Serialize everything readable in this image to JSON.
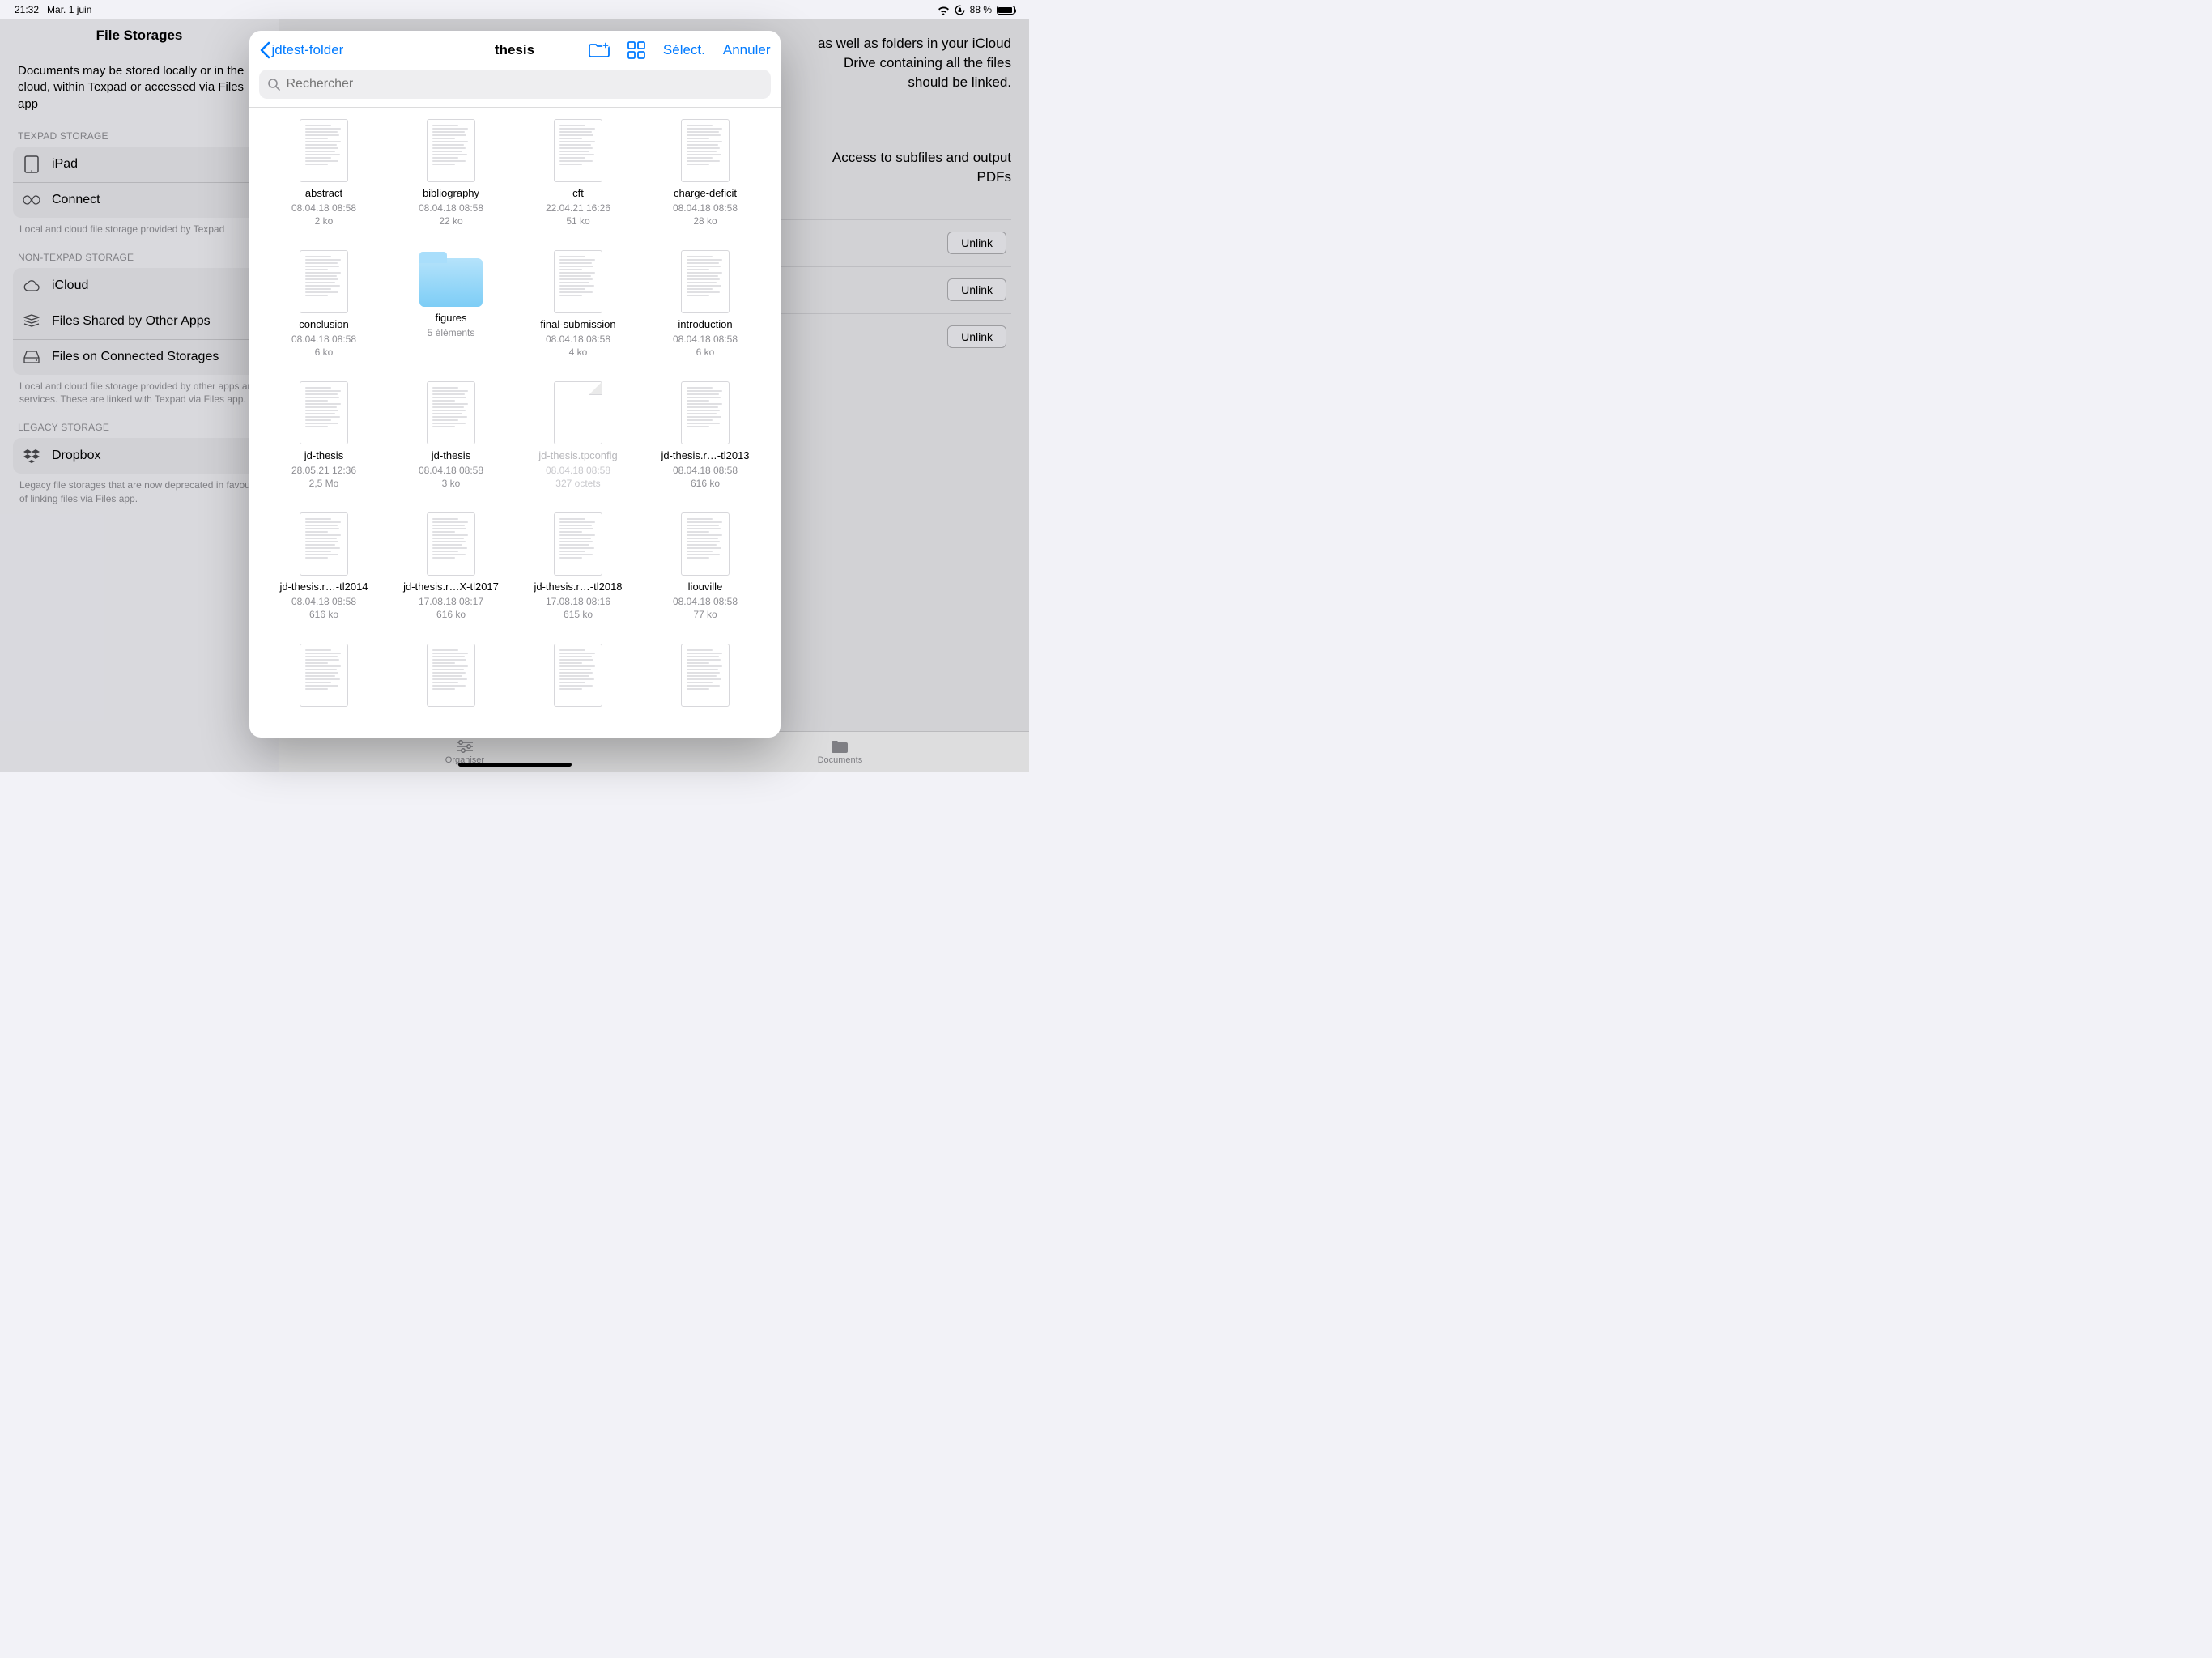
{
  "status": {
    "time": "21:32",
    "date": "Mar. 1 juin",
    "battery_pct": "88 %"
  },
  "sidebar": {
    "title": "File Storages",
    "intro": "Documents may be stored locally or in the cloud, within Texpad or accessed via Files app",
    "group_texpad_label": "TEXPAD STORAGE",
    "ipad_label": "iPad",
    "connect_label": "Connect",
    "group_texpad_note": "Local and cloud file storage provided by Texpad",
    "group_nontexpad_label": "NON-TEXPAD STORAGE",
    "icloud_label": "iCloud",
    "shared_label": "Files Shared by Other Apps",
    "connstor_label": "Files on Connected Storages",
    "group_nontexpad_note": "Local and cloud file storage provided by other apps and services. These are linked with Texpad via Files app.",
    "group_legacy_label": "LEGACY STORAGE",
    "dropbox_label": "Dropbox",
    "group_legacy_note": "Legacy file storages that are now deprecated in favour of linking files via Files app."
  },
  "main": {
    "text_right": "as well as folders in your iCloud Drive containing all the files should be linked.",
    "sub_right": "Access to subfiles and output PDFs",
    "unlink_label": "Unlink"
  },
  "tabs": {
    "organise": "Organiser",
    "documents": "Documents"
  },
  "modal": {
    "back_label": "jdtest-folder",
    "title": "thesis",
    "select_label": "Sélect.",
    "cancel_label": "Annuler",
    "search_placeholder": "Rechercher"
  },
  "files": [
    {
      "kind": "doc",
      "name": "abstract",
      "line1": "08.04.18 08:58",
      "line2": "2 ko"
    },
    {
      "kind": "doc",
      "name": "bibliography",
      "line1": "08.04.18 08:58",
      "line2": "22 ko"
    },
    {
      "kind": "doc",
      "name": "cft",
      "line1": "22.04.21 16:26",
      "line2": "51 ko"
    },
    {
      "kind": "doc",
      "name": "charge-deficit",
      "line1": "08.04.18 08:58",
      "line2": "28 ko"
    },
    {
      "kind": "doc",
      "name": "conclusion",
      "line1": "08.04.18 08:58",
      "line2": "6 ko"
    },
    {
      "kind": "folder",
      "name": "figures",
      "line1": "5 éléments",
      "line2": ""
    },
    {
      "kind": "doc",
      "name": "final-submission",
      "line1": "08.04.18 08:58",
      "line2": "4 ko"
    },
    {
      "kind": "doc",
      "name": "introduction",
      "line1": "08.04.18 08:58",
      "line2": "6 ko"
    },
    {
      "kind": "doc",
      "name": "jd-thesis",
      "line1": "28.05.21 12:36",
      "line2": "2,5 Mo"
    },
    {
      "kind": "doc",
      "name": "jd-thesis",
      "line1": "08.04.18 08:58",
      "line2": "3 ko"
    },
    {
      "kind": "blank",
      "dim": true,
      "name": "jd-thesis.tpconfig",
      "line1": "08.04.18 08:58",
      "line2": "327 octets"
    },
    {
      "kind": "doc",
      "name": "jd-thesis.r…-tl2013",
      "line1": "08.04.18 08:58",
      "line2": "616 ko"
    },
    {
      "kind": "doc",
      "name": "jd-thesis.r…-tl2014",
      "line1": "08.04.18 08:58",
      "line2": "616 ko"
    },
    {
      "kind": "doc",
      "name": "jd-thesis.r…X-tl2017",
      "line1": "17.08.18 08:17",
      "line2": "616 ko"
    },
    {
      "kind": "doc",
      "name": "jd-thesis.r…-tl2018",
      "line1": "17.08.18 08:16",
      "line2": "615 ko"
    },
    {
      "kind": "doc",
      "name": "liouville",
      "line1": "08.04.18 08:58",
      "line2": "77 ko"
    },
    {
      "kind": "doc",
      "name": "",
      "line1": "",
      "line2": ""
    },
    {
      "kind": "doc",
      "name": "",
      "line1": "",
      "line2": ""
    },
    {
      "kind": "doc",
      "name": "",
      "line1": "",
      "line2": ""
    },
    {
      "kind": "doc",
      "name": "",
      "line1": "",
      "line2": ""
    }
  ]
}
